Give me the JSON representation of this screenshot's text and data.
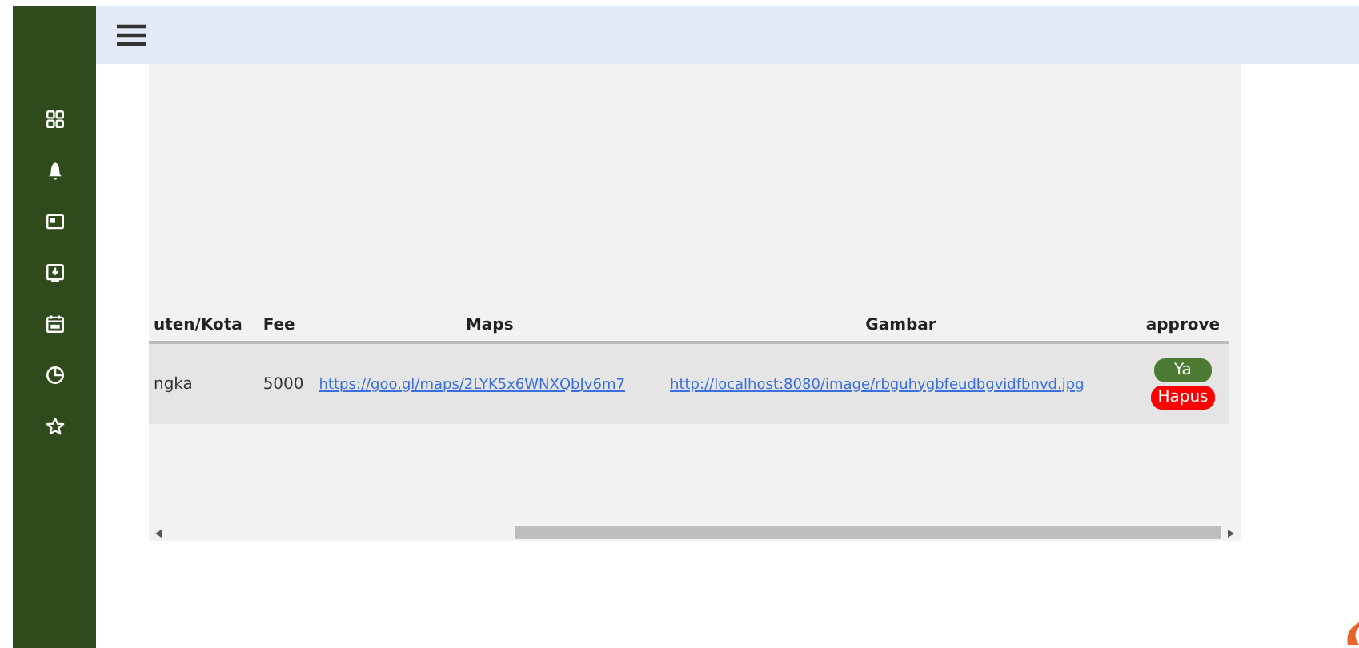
{
  "table": {
    "columns": [
      "uten/Kota",
      "Fee",
      "Maps",
      "Gambar",
      "approve"
    ],
    "rows": [
      {
        "cells": [
          "ngka",
          "5000"
        ],
        "maps": "https://goo.gl/maps/2LYK5x6WNXQbJv6m7",
        "gambar": "http://localhost:8080/image/rbguhygbfeudbgvidfbnvd.jpg",
        "actions": [
          {
            "label": "Ya",
            "kind": "approve"
          },
          {
            "label": "Hapus",
            "kind": "delete"
          }
        ]
      }
    ]
  }
}
